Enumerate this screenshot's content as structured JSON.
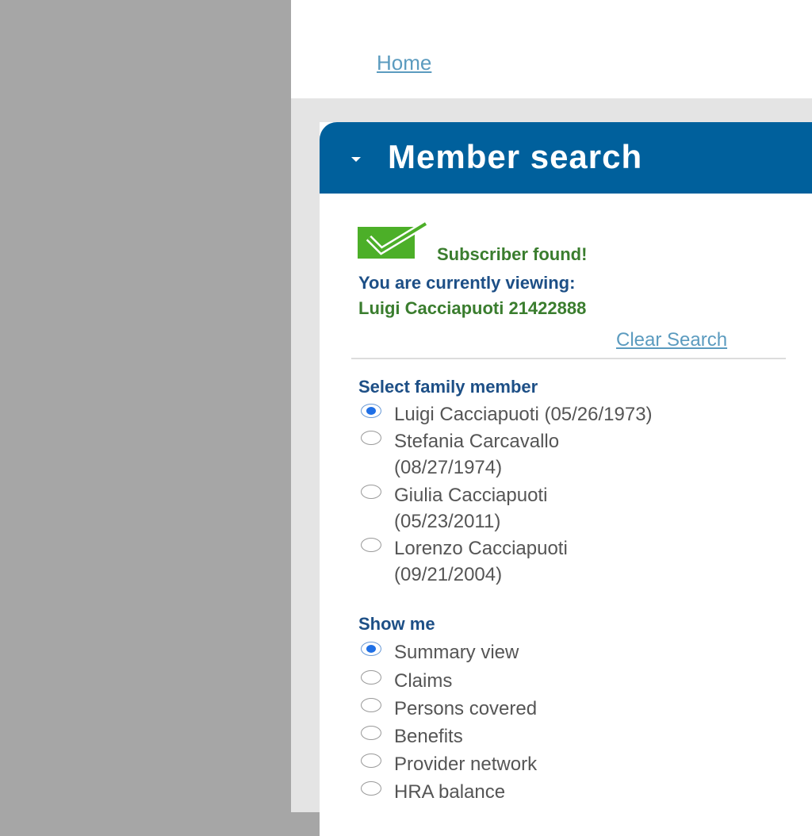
{
  "breadcrumb": {
    "home_label": "Home"
  },
  "panel": {
    "title": "Member search",
    "status": {
      "message": "Subscriber found!",
      "viewing_label": "You are currently viewing:",
      "viewing_value": "Luigi Cacciapuoti 21422888",
      "clear_label": "Clear Search"
    },
    "family": {
      "label": "Select family member",
      "options": [
        {
          "label": "Luigi Cacciapuoti (05/26/1973)",
          "checked": true
        },
        {
          "line1": "Stefania Carcavallo",
          "line2": "(08/27/1974)",
          "checked": false
        },
        {
          "line1": "Giulia Cacciapuoti",
          "line2": "(05/23/2011)",
          "checked": false
        },
        {
          "line1": "Lorenzo Cacciapuoti",
          "line2": "(09/21/2004)",
          "checked": false
        }
      ]
    },
    "show_me": {
      "label": "Show me",
      "options": [
        {
          "label": "Summary view",
          "checked": true
        },
        {
          "label": "Claims",
          "checked": false
        },
        {
          "label": "Persons covered",
          "checked": false
        },
        {
          "label": "Benefits",
          "checked": false
        },
        {
          "label": "Provider network",
          "checked": false
        },
        {
          "label": "HRA balance",
          "checked": false
        }
      ]
    }
  },
  "colors": {
    "header_blue": "#00609c",
    "success_green": "#3a7d2e",
    "label_navy": "#1d4f86",
    "link_blue": "#5b9bbf"
  }
}
